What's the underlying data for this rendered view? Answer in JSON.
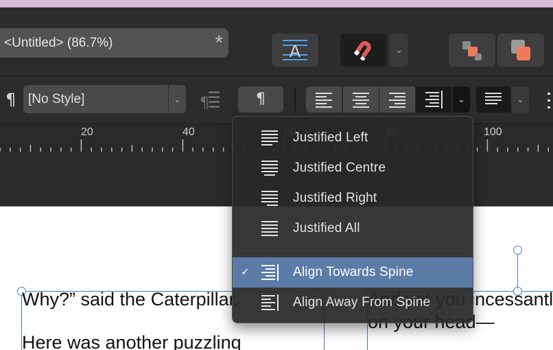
{
  "document": {
    "title": "<Untitled> (86.7%)",
    "modified_marker": "*"
  },
  "paragraph_bar": {
    "style_select": {
      "value": "[No Style]"
    },
    "pilcrow": "¶",
    "para_button": "¶",
    "dropdown_glyph": "⌄"
  },
  "ruler": {
    "labels": [
      "20",
      "40",
      "60",
      "80",
      "100"
    ]
  },
  "align_menu": {
    "items": [
      {
        "label": "Justified Left",
        "icon": "justified-left-icon",
        "selected": false
      },
      {
        "label": "Justified Centre",
        "icon": "justified-centre-icon",
        "selected": false
      },
      {
        "label": "Justified Right",
        "icon": "justified-right-icon",
        "selected": false
      },
      {
        "label": "Justified All",
        "icon": "justified-all-icon",
        "selected": false
      },
      {
        "label": "Align Towards Spine",
        "icon": "align-towards-spine-icon",
        "selected": true
      },
      {
        "label": "Align Away From Spine",
        "icon": "align-away-from-spine-icon",
        "selected": false
      }
    ],
    "checkmark": "✓"
  },
  "canvas_text": {
    "left_line1": "Why?” said the Caterpillar.",
    "left_line2": "Here was another puzzling",
    "right_line1": "And yet you incessantly",
    "right_line2": "on your head—"
  },
  "colors": {
    "accent_selected": "#5c7ca8",
    "selection_blue": "#3d7bd1",
    "magnet_red": "#e05a5a",
    "arrange_orange": "#f07a5c"
  }
}
